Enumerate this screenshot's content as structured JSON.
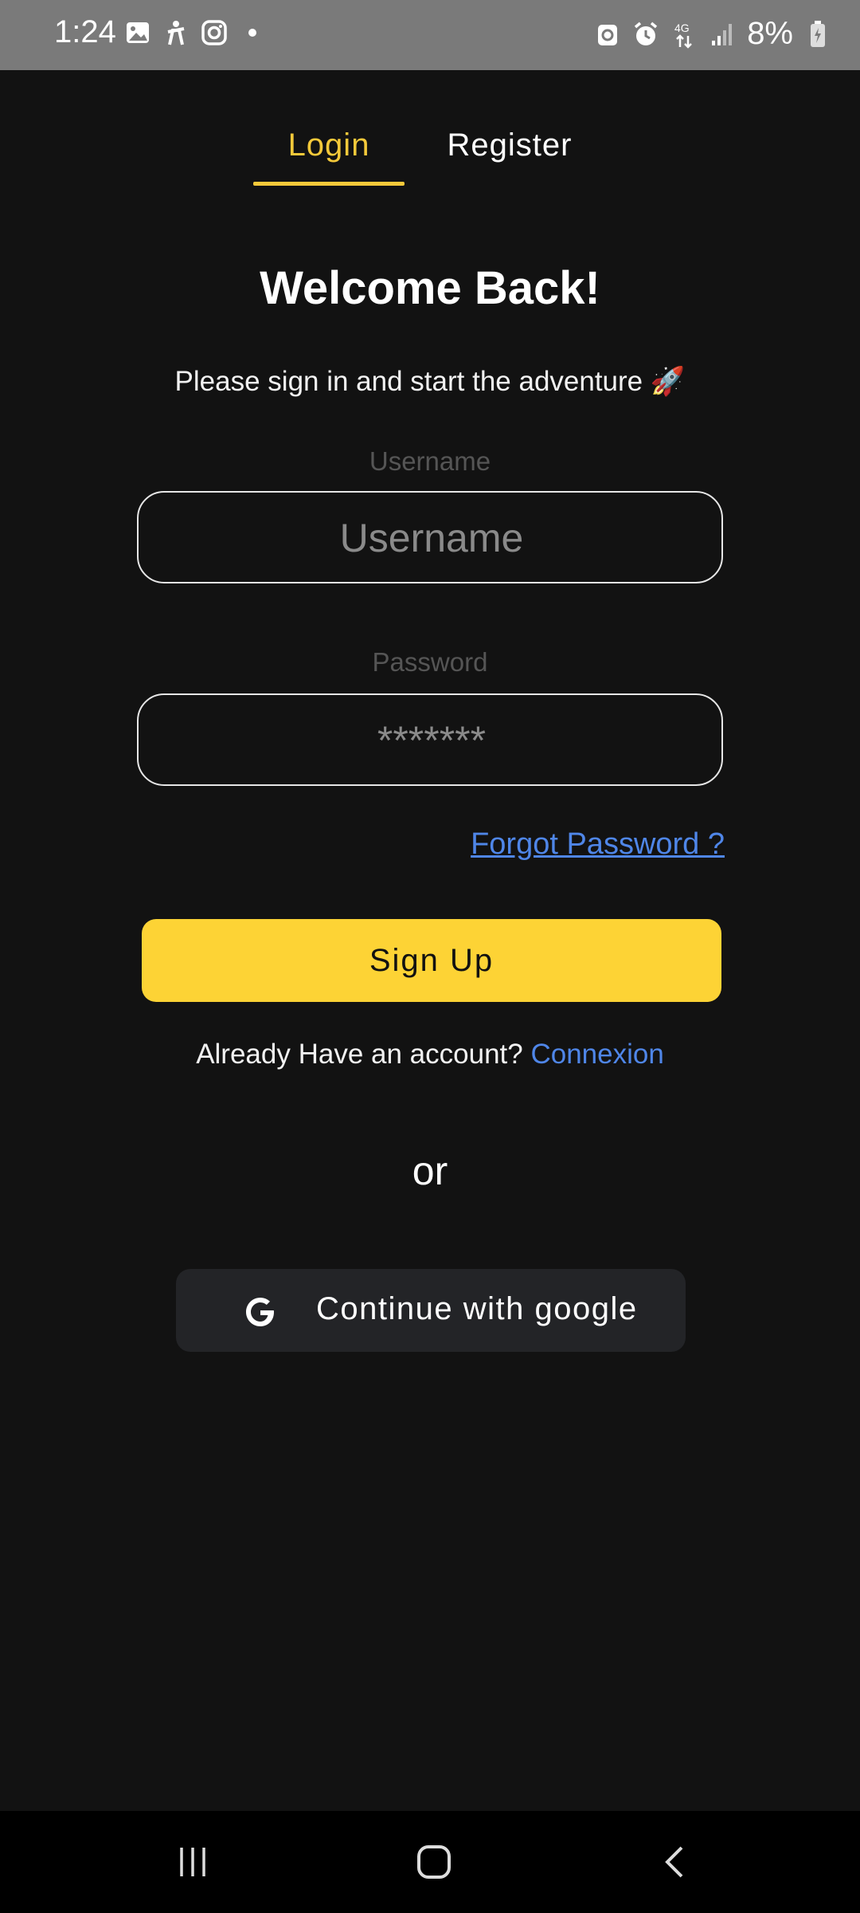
{
  "status_bar": {
    "time": "1:24",
    "battery_text": "8%",
    "left_icons": [
      "gallery-icon",
      "accessibility-icon",
      "instagram-icon",
      "dot-icon"
    ],
    "right_icons": [
      "recycle-icon",
      "alarm-icon",
      "network-4g-icon",
      "signal-icon",
      "battery-icon"
    ],
    "network_label": "4G"
  },
  "tabs": [
    {
      "label": "Login",
      "active": true
    },
    {
      "label": "Register",
      "active": false
    }
  ],
  "header": {
    "title": "Welcome Back!",
    "subtitle": "Please sign in and start the adventure 🚀"
  },
  "form": {
    "username": {
      "label": "Username",
      "placeholder": "Username",
      "value": ""
    },
    "password": {
      "label": "Password",
      "placeholder": "*******",
      "value": ""
    },
    "forgot_label": "Forgot Password ?",
    "submit_label": "Sign Up"
  },
  "account": {
    "prompt": "Already Have an account?",
    "link": "Connexion"
  },
  "divider_text": "or",
  "google": {
    "label": "Continue with google",
    "icon": "google-icon"
  },
  "colors": {
    "background": "#121212",
    "accent": "#fdd335",
    "link": "#4f86e8",
    "status_bar": "#7a7a7a"
  },
  "nav_bar": {
    "items": [
      "recent-apps-icon",
      "home-icon",
      "back-icon"
    ]
  }
}
